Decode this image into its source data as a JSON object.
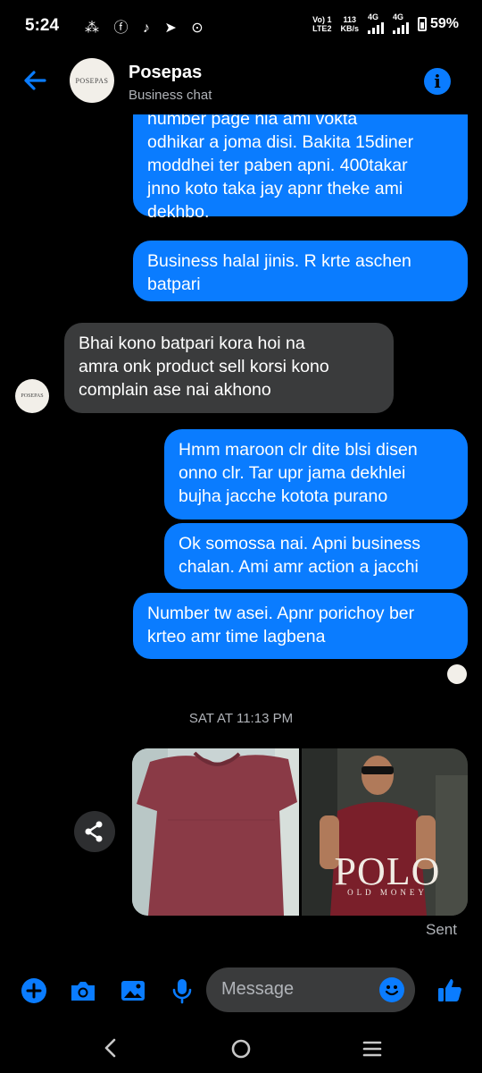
{
  "status_bar": {
    "time": "5:24",
    "notif_icons": "⁂ ⓕ ♪ ➤ ⊙",
    "volte": "Vo) 1",
    "lte": "LTE2",
    "speed_value": "113",
    "speed_unit": "KB/s",
    "net1": "4G",
    "net2": "4G",
    "battery": "59%"
  },
  "header": {
    "title": "Posepas",
    "subtitle": "Business chat",
    "avatar_text": "POSEPAS",
    "icons": [
      "back-arrow-icon",
      "info-icon"
    ]
  },
  "messages": [
    {
      "side": "out",
      "text": "number page nia ami vokta\nodhikar a joma disi. Bakita 15diner\nmoddhei ter paben apni. 400takar\njnno koto taka jay apnr theke ami\ndekhbo."
    },
    {
      "side": "out",
      "text": "Business halal jinis. R krte aschen\nbatpari"
    },
    {
      "side": "in",
      "text": "Bhai kono batpari kora hoi na\namra onk product sell korsi kono\ncomplain ase nai akhono"
    },
    {
      "side": "out",
      "text": "Hmm maroon clr dite blsi disen\nonno clr. Tar upr jama dekhlei\nbujha jacche kotota purano"
    },
    {
      "side": "out",
      "text": "Ok somossa nai. Apni business\nchalan. Ami amr action a jacchi"
    },
    {
      "side": "out",
      "text": "Number tw asei. Apnr porichoy ber\nkrteo amr time lagbena"
    }
  ],
  "timestamp": "SAT AT 11:13 PM",
  "photos": {
    "polo_title": "POLO",
    "polo_sub": "OLD MONEY"
  },
  "sent_label": "Sent",
  "input": {
    "placeholder": "Message"
  },
  "colors": {
    "accent": "#0a7cff",
    "incoming_bubble": "#3a3b3c",
    "background": "#000000"
  }
}
